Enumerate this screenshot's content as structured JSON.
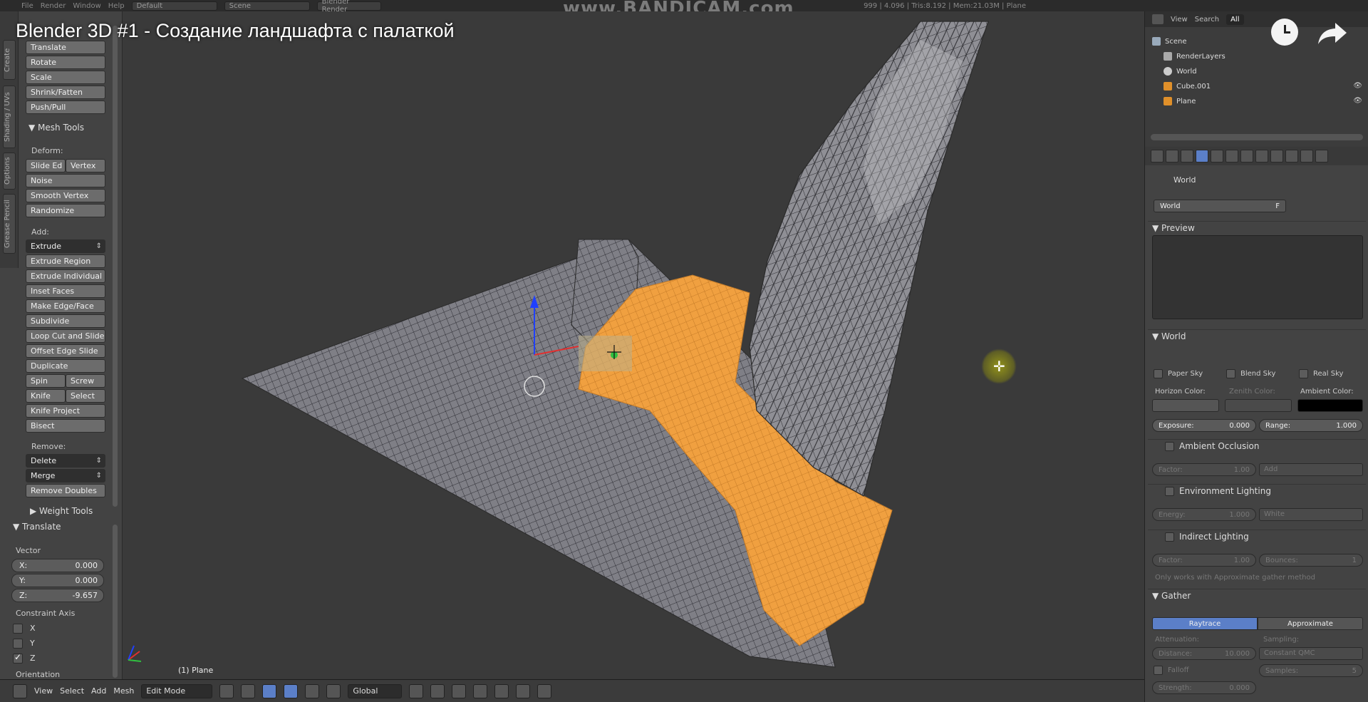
{
  "video": {
    "title": "Blender 3D #1 - Создание ландшафта с палаткой",
    "watermark": "www.BANDICAM.com"
  },
  "topbar": {
    "menus": [
      "File",
      "Render",
      "Window",
      "Help"
    ],
    "layout": "Default",
    "scene": "Scene",
    "engine": "Blender Render",
    "stats": "999 | 4.096 | Tris:8.192 | Mem:21.03M | Plane"
  },
  "shelf": {
    "tabs": [
      "Create",
      "Shading / UVs",
      "Options",
      "Grease Pencil"
    ],
    "transform": [
      "Translate",
      "Rotate",
      "Scale",
      "Shrink/Fatten",
      "Push/Pull"
    ],
    "mesh_tools_header": "▼ Mesh Tools",
    "deform_label": "Deform:",
    "deform_row1": [
      "Slide Ed",
      "Vertex"
    ],
    "deform": [
      "Noise",
      "Smooth Vertex",
      "Randomize"
    ],
    "add_label": "Add:",
    "extrude": "Extrude",
    "add": [
      "Extrude Region",
      "Extrude Individual",
      "Inset Faces",
      "Make Edge/Face",
      "Subdivide",
      "Loop Cut and Slide",
      "Offset Edge Slide",
      "Duplicate"
    ],
    "add_pairs": [
      [
        "Spin",
        "Screw"
      ],
      [
        "Knife",
        "Select"
      ]
    ],
    "add_more": [
      "Knife Project",
      "Bisect"
    ],
    "remove_label": "Remove:",
    "delete": "Delete",
    "merge": "Merge",
    "remove_doubles": "Remove Doubles",
    "weight_tools_header": "▶ Weight Tools",
    "operator_header": "▼ Translate",
    "vector_label": "Vector",
    "vector": [
      {
        "axis": "X:",
        "value": "0.000"
      },
      {
        "axis": "Y:",
        "value": "0.000"
      },
      {
        "axis": "Z:",
        "value": "-9.657"
      }
    ],
    "constraint_label": "Constraint Axis",
    "constraints": [
      {
        "axis": "X",
        "checked": false
      },
      {
        "axis": "Y",
        "checked": false
      },
      {
        "axis": "Z",
        "checked": true
      }
    ],
    "orientation_label": "Orientation"
  },
  "viewport": {
    "object_label": "(1) Plane"
  },
  "bottombar": {
    "menus": [
      "View",
      "Select",
      "Add",
      "Mesh"
    ],
    "mode": "Edit Mode",
    "orientation": "Global"
  },
  "outliner": {
    "header": [
      "View",
      "Search",
      "All"
    ],
    "rows": [
      {
        "label": "Scene",
        "indent": 0
      },
      {
        "label": "RenderLayers",
        "indent": 1
      },
      {
        "label": "World",
        "indent": 1
      },
      {
        "label": "Cube.001",
        "indent": 1
      },
      {
        "label": "Plane",
        "indent": 1
      }
    ]
  },
  "properties": {
    "breadcrumb": "World",
    "world_name": "World",
    "world_name_flag": "F",
    "preview_header": "▼ Preview",
    "world_header": "▼ World",
    "sky_options": [
      "Paper Sky",
      "Blend Sky",
      "Real Sky"
    ],
    "color_labels": [
      "Horizon Color:",
      "Zenith Color:",
      "Ambient Color:"
    ],
    "exposure": {
      "label": "Exposure:",
      "value": "0.000"
    },
    "range": {
      "label": "Range:",
      "value": "1.000"
    },
    "ao_header": "Ambient Occlusion",
    "ao_factor": {
      "label": "Factor:",
      "value": "1.00"
    },
    "ao_mode": "Add",
    "env_header": "Environment Lighting",
    "env_energy": {
      "label": "Energy:",
      "value": "1.000"
    },
    "env_mode": "White",
    "indirect_header": "Indirect Lighting",
    "indirect_factor": {
      "label": "Factor:",
      "value": "1.00"
    },
    "indirect_bounces": {
      "label": "Bounces:",
      "value": "1"
    },
    "indirect_note": "Only works with Approximate gather method",
    "gather_header": "▼ Gather",
    "gather_tabs": [
      "Raytrace",
      "Approximate"
    ],
    "attenuation_label": "Attenuation:",
    "sampling_label": "Sampling:",
    "distance": {
      "label": "Distance:",
      "value": "10.000"
    },
    "sampling_mode": "Constant QMC",
    "falloff_label": "Falloff",
    "samples": {
      "label": "Samples:",
      "value": "5"
    },
    "strength": {
      "label": "Strength:",
      "value": "0.000"
    }
  },
  "colors": {
    "selection": "#f0a040",
    "mesh": "#8a8a8a",
    "accent": "#5b7fc8"
  }
}
